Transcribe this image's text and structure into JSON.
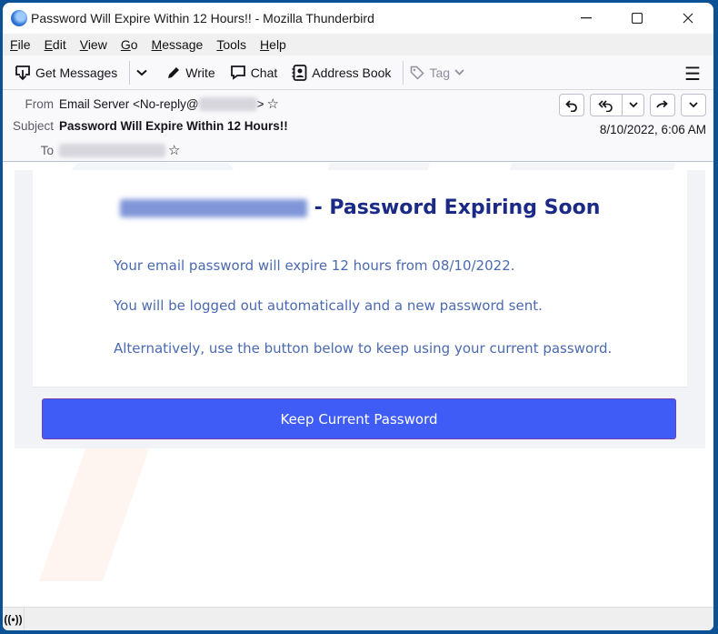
{
  "window": {
    "title": "Password Will Expire Within 12 Hours!! - Mozilla Thunderbird",
    "controls": {
      "minimize": "—",
      "maximize": "☐",
      "close": "✕"
    }
  },
  "menubar": [
    {
      "label": "File",
      "accel": "F",
      "rest": "ile"
    },
    {
      "label": "Edit",
      "accel": "E",
      "rest": "dit"
    },
    {
      "label": "View",
      "accel": "V",
      "rest": "iew"
    },
    {
      "label": "Go",
      "accel": "G",
      "rest": "o"
    },
    {
      "label": "Message",
      "accel": "M",
      "rest": "essage"
    },
    {
      "label": "Tools",
      "accel": "T",
      "rest": "ools"
    },
    {
      "label": "Help",
      "accel": "H",
      "rest": "elp"
    }
  ],
  "toolbar": {
    "get_messages": "Get Messages",
    "write": "Write",
    "chat": "Chat",
    "address_book": "Address Book",
    "tag": "Tag",
    "menu_icon": "☰"
  },
  "header": {
    "from_label": "From",
    "from_value": "Email Server <No-reply@",
    "from_suffix": ">",
    "subject_label": "Subject",
    "subject_value": "Password Will Expire Within 12 Hours!!",
    "to_label": "To",
    "date": "8/10/2022, 6:06 AM",
    "star": "☆",
    "actions": {
      "reply": "↶",
      "reply_all": "«",
      "dropdown": "⌄",
      "forward": "→",
      "more": "⌄"
    }
  },
  "message": {
    "heading_suffix": "- Password Expiring Soon",
    "paragraphs": [
      "Your email password will expire 12 hours from 08/10/2022.",
      "You will be logged out automatically and a new password sent.",
      "Alternatively, use the button below to keep using your current password."
    ],
    "button_label": "Keep Current Password",
    "button_color": "#3f5cf7",
    "heading_color": "#1a2a86",
    "text_color": "#4b6ab0"
  },
  "statusbar": {
    "icon": "((•))"
  }
}
